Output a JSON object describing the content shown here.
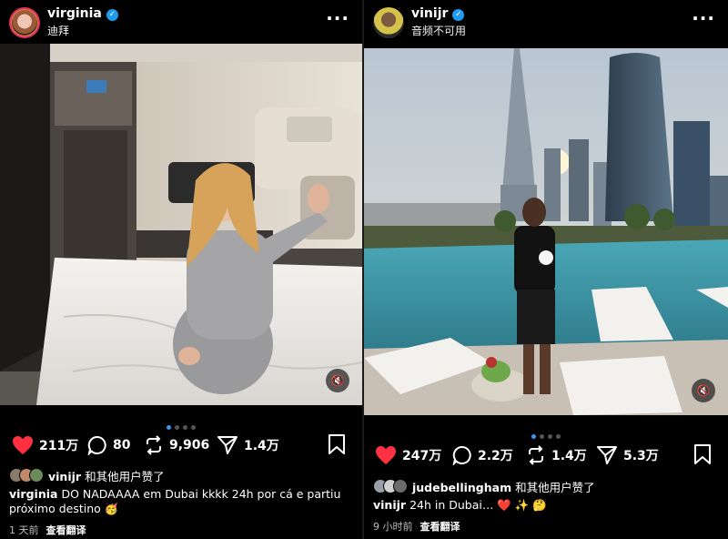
{
  "left_post": {
    "username": "virginia",
    "location": "迪拜",
    "more_icon": "more-horizontal-icon",
    "mute_icon": "speaker-muted-icon",
    "carousel": {
      "count": 4,
      "active": 1
    },
    "likes": "211万",
    "comments": "80",
    "reposts": "9,906",
    "shares": "1.4万",
    "liked_by_user": "vinijr",
    "liked_by_suffix": "和其他用户赞了",
    "caption_user": "virginia",
    "caption_text": "DO NADAAAA em Dubai kkkk 24h por cá e partiu próximo destino 🥳",
    "time_ago": "1 天前",
    "translate": "查看翻译"
  },
  "right_post": {
    "username": "vinijr",
    "subtitle": "音频不可用",
    "more_icon": "more-horizontal-icon",
    "mute_icon": "speaker-muted-icon",
    "carousel": {
      "count": 4,
      "active": 1
    },
    "likes": "247万",
    "comments": "2.2万",
    "reposts": "1.4万",
    "shares": "5.3万",
    "liked_by_user": "judebellingham",
    "liked_by_suffix": "和其他用户赞了",
    "caption_user": "vinijr",
    "caption_text": "24h in Dubai… ❤️ ✨ 🤔",
    "time_ago": "9 小时前",
    "translate": "查看翻译"
  },
  "colors": {
    "like_red": "#ff3040",
    "verified_blue": "#1d9bf0",
    "dot_active": "#3897f0",
    "background": "#000000"
  }
}
